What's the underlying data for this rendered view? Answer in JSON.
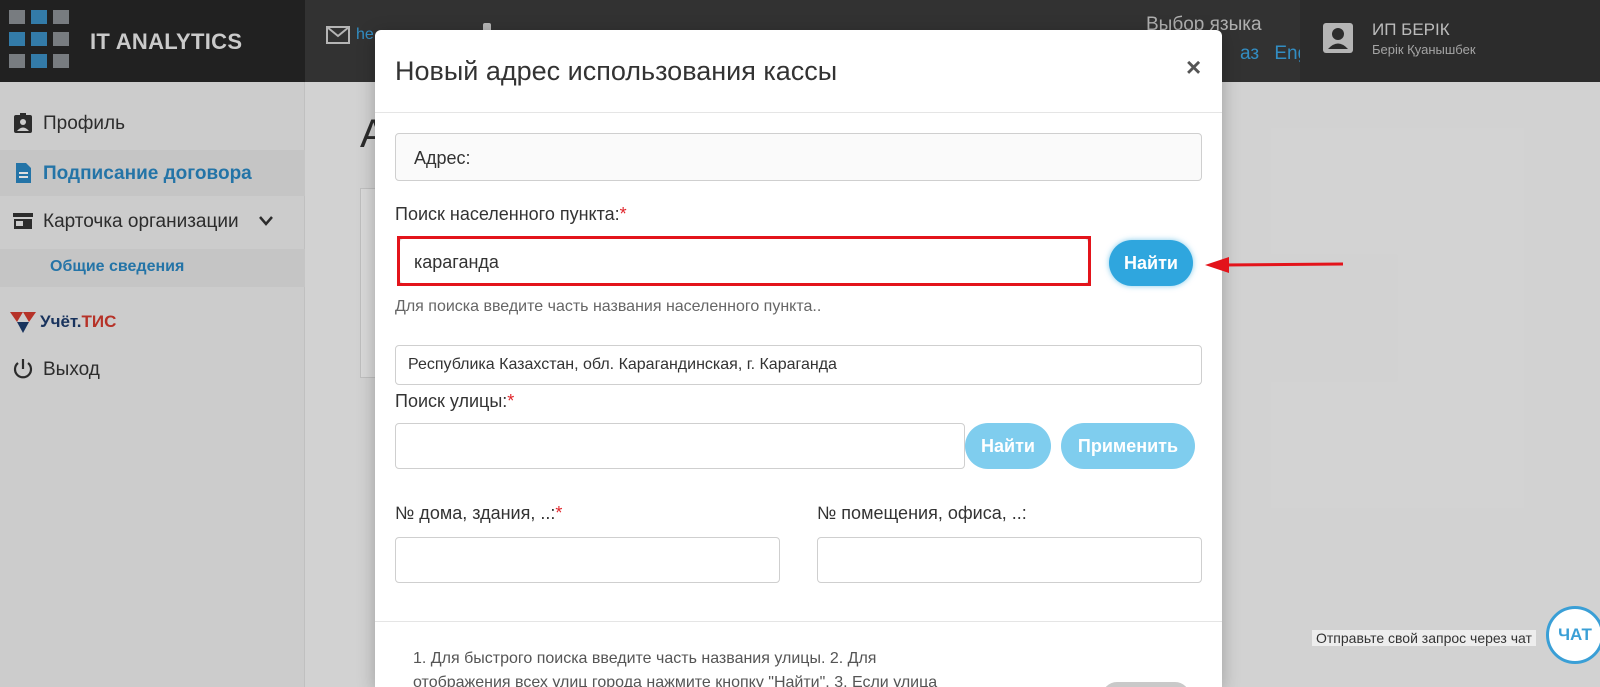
{
  "header": {
    "brand": "IT ANALYTICS",
    "contact_text": "he",
    "lang_label": "Выбор языка",
    "lang_options": [
      "аз",
      "Eng"
    ],
    "user_name": "ИП БЕРІК",
    "user_sub": "Берік Қуанышбек"
  },
  "sidebar": {
    "items": [
      {
        "label": "Профиль",
        "icon": "profile-icon"
      },
      {
        "label": "Подписание договора",
        "icon": "document-icon"
      },
      {
        "label": "Карточка организации",
        "icon": "store-icon"
      }
    ],
    "subitem": "Общие сведения",
    "uchet_text": "Учёт.",
    "uchet_accent": "ТИС",
    "logout": "Выход"
  },
  "page": {
    "title_char": "А"
  },
  "modal": {
    "title": "Новый адрес использования кассы",
    "close": "×",
    "address_label": "Адрес:",
    "city_search_label": "Поиск населенного пункта:",
    "city_search_value": "караганда",
    "find_button": "Найти",
    "city_help": "Для поиска введите часть названия населенного пункта..",
    "city_result": "Республика Казахстан, обл. Карагандинская, г. Караганда",
    "street_search_label": "Поиск улицы:",
    "street_search_value": "",
    "street_find_button": "Найти",
    "apply_button": "Применить",
    "house_label": "№ дома, здания, ..:",
    "house_value": "",
    "office_label": "№ помещения, офиса, ..:",
    "office_value": "",
    "required_mark": "*",
    "footer_text": "1. Для быстрого поиска введите часть названия улицы. 2. Для отображения всех улиц города нажмите кнопку \"Найти\". 3. Если улица"
  },
  "chat": {
    "prompt": "Отправьте свой запрос через чат",
    "button": "ЧАТ"
  },
  "colors": {
    "accent": "#2fa6de",
    "highlight": "#e3141b",
    "topbar": "#3a3a3a"
  }
}
